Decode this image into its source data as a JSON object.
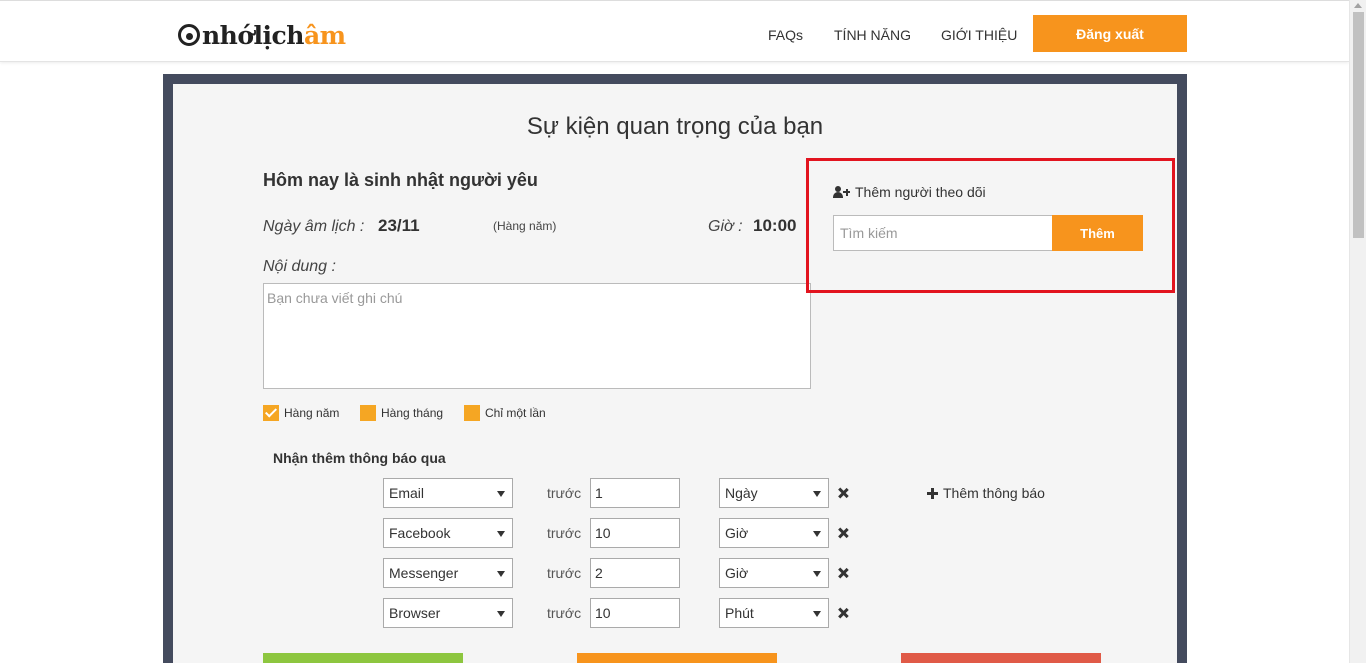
{
  "header": {
    "logo": {
      "prefix": "nhớ",
      "middle": "lịch",
      "accent": "âm"
    },
    "nav": [
      "FAQs",
      "TÍNH NĂNG",
      "GIỚI THIỆU"
    ],
    "logout_label": "Đăng xuất"
  },
  "main": {
    "title": "Sự kiện quan trọng của bạn",
    "event_name": "Hôm nay là sinh nhật người yêu",
    "lunar_label": "Ngày âm lịch :",
    "lunar_date": "23/11",
    "repeat_note": "(Hàng năm)",
    "time_label": "Giờ :",
    "time_value": "10:00",
    "content_label": "Nội dung :",
    "note_placeholder": "Bạn chưa viết ghi chú",
    "frequency": [
      {
        "label": "Hàng năm",
        "checked": true
      },
      {
        "label": "Hàng tháng",
        "checked": false
      },
      {
        "label": "Chỉ một lần",
        "checked": false
      }
    ],
    "notify_heading": "Nhận thêm thông báo qua",
    "before_label": "trước",
    "reminders": [
      {
        "channel": "Email",
        "amount": "1",
        "unit": "Ngày"
      },
      {
        "channel": "Facebook",
        "amount": "10",
        "unit": "Giờ"
      },
      {
        "channel": "Messenger",
        "amount": "2",
        "unit": "Giờ"
      },
      {
        "channel": "Browser",
        "amount": "10",
        "unit": "Phút"
      }
    ],
    "add_notify_label": "Thêm thông báo",
    "bottom_buttons_colors": [
      "#8dc63f",
      "#f7941d",
      "#e05a47"
    ]
  },
  "follower": {
    "title": "Thêm người theo dõi",
    "search_placeholder": "Tìm kiếm",
    "add_label": "Thêm"
  },
  "colors": {
    "accent": "#f7941d",
    "checkbox": "#f5a623",
    "frame": "#444b5e",
    "highlight": "#e2141f"
  }
}
